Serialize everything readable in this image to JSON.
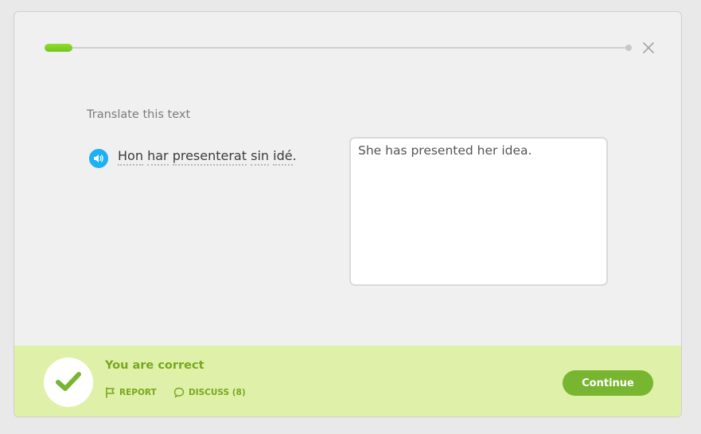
{
  "progress": {
    "fraction": 0.048
  },
  "prompt": {
    "label": "Translate this text"
  },
  "sentence": {
    "words": [
      "Hon",
      "har",
      "presenterat",
      "sin",
      "idé"
    ],
    "punctuation": "."
  },
  "answer": {
    "value": "She has presented her idea."
  },
  "feedback": {
    "title": "You are correct",
    "report_label": "REPORT",
    "discuss_label": "DISCUSS (8)",
    "continue_label": "Continue"
  },
  "colors": {
    "accent_blue": "#1cb0f6",
    "progress_green": "#7ccf22",
    "footer_bg": "#dff0a9",
    "footer_text": "#78a820",
    "button_green": "#78b530"
  },
  "icons": {
    "close": "close-icon",
    "speaker": "speaker-icon",
    "check": "checkmark-icon",
    "report": "flag-icon",
    "discuss": "speech-bubble-icon"
  }
}
